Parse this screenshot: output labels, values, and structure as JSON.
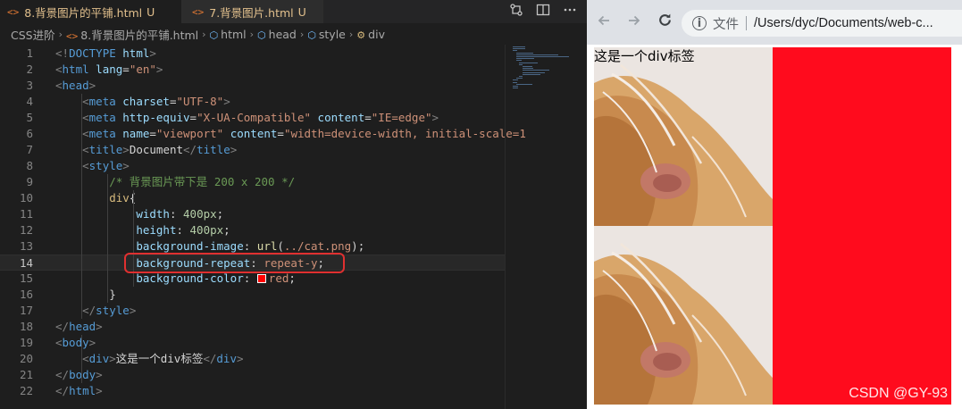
{
  "editor": {
    "tabs": [
      {
        "icon": "<>",
        "label": "8.背景图片的平铺.html",
        "badge": "U",
        "active": true
      },
      {
        "icon": "<>",
        "label": "7.背景图片.html",
        "badge": "U",
        "active": false
      }
    ],
    "breadcrumb": [
      {
        "label": "CSS进阶",
        "icon": ""
      },
      {
        "label": "8.背景图片的平铺.html",
        "icon": "<>"
      },
      {
        "label": "html",
        "icon": "box"
      },
      {
        "label": "head",
        "icon": "box"
      },
      {
        "label": "style",
        "icon": "box"
      },
      {
        "label": "div",
        "icon": "selector"
      }
    ],
    "active_line": 14,
    "lines": [
      {
        "n": "1",
        "tokens": [
          [
            "t-punc",
            "<!"
          ],
          [
            "t-doctype",
            "DOCTYPE"
          ],
          [
            "t-text",
            " "
          ],
          [
            "t-attr",
            "html"
          ],
          [
            "t-punc",
            ">"
          ]
        ]
      },
      {
        "n": "2",
        "tokens": [
          [
            "t-punc",
            "<"
          ],
          [
            "t-tag",
            "html"
          ],
          [
            "t-text",
            " "
          ],
          [
            "t-attr",
            "lang"
          ],
          [
            "t-text",
            "="
          ],
          [
            "t-str",
            "\"en\""
          ],
          [
            "t-punc",
            ">"
          ]
        ]
      },
      {
        "n": "3",
        "tokens": [
          [
            "t-punc",
            "<"
          ],
          [
            "t-tag",
            "head"
          ],
          [
            "t-punc",
            ">"
          ]
        ]
      },
      {
        "n": "4",
        "tokens": [
          [
            "t-text",
            "    "
          ],
          [
            "t-punc",
            "<"
          ],
          [
            "t-tag",
            "meta"
          ],
          [
            "t-text",
            " "
          ],
          [
            "t-attr",
            "charset"
          ],
          [
            "t-text",
            "="
          ],
          [
            "t-str",
            "\"UTF-8\""
          ],
          [
            "t-punc",
            ">"
          ]
        ]
      },
      {
        "n": "5",
        "tokens": [
          [
            "t-text",
            "    "
          ],
          [
            "t-punc",
            "<"
          ],
          [
            "t-tag",
            "meta"
          ],
          [
            "t-text",
            " "
          ],
          [
            "t-attr",
            "http-equiv"
          ],
          [
            "t-text",
            "="
          ],
          [
            "t-str",
            "\"X-UA-Compatible\""
          ],
          [
            "t-text",
            " "
          ],
          [
            "t-attr",
            "content"
          ],
          [
            "t-text",
            "="
          ],
          [
            "t-str",
            "\"IE=edge\""
          ],
          [
            "t-punc",
            ">"
          ]
        ]
      },
      {
        "n": "6",
        "tokens": [
          [
            "t-text",
            "    "
          ],
          [
            "t-punc",
            "<"
          ],
          [
            "t-tag",
            "meta"
          ],
          [
            "t-text",
            " "
          ],
          [
            "t-attr",
            "name"
          ],
          [
            "t-text",
            "="
          ],
          [
            "t-str",
            "\"viewport\""
          ],
          [
            "t-text",
            " "
          ],
          [
            "t-attr",
            "content"
          ],
          [
            "t-text",
            "="
          ],
          [
            "t-str",
            "\"width=device-width, initial-scale=1"
          ]
        ]
      },
      {
        "n": "7",
        "tokens": [
          [
            "t-text",
            "    "
          ],
          [
            "t-punc",
            "<"
          ],
          [
            "t-tag",
            "title"
          ],
          [
            "t-punc",
            ">"
          ],
          [
            "t-text",
            "Document"
          ],
          [
            "t-punc",
            "</"
          ],
          [
            "t-tag",
            "title"
          ],
          [
            "t-punc",
            ">"
          ]
        ]
      },
      {
        "n": "8",
        "tokens": [
          [
            "t-text",
            "    "
          ],
          [
            "t-punc",
            "<"
          ],
          [
            "t-tag",
            "style"
          ],
          [
            "t-punc",
            ">"
          ]
        ]
      },
      {
        "n": "9",
        "tokens": [
          [
            "t-text",
            "        "
          ],
          [
            "t-comment",
            "/* 背景图片带下是 200 x 200 */"
          ]
        ]
      },
      {
        "n": "10",
        "tokens": [
          [
            "t-text",
            "        "
          ],
          [
            "t-sel",
            "div"
          ],
          [
            "t-text",
            "{"
          ]
        ]
      },
      {
        "n": "11",
        "tokens": [
          [
            "t-text",
            "            "
          ],
          [
            "t-prop",
            "width"
          ],
          [
            "t-text",
            ": "
          ],
          [
            "t-num",
            "400px"
          ],
          [
            "t-text",
            ";"
          ]
        ]
      },
      {
        "n": "12",
        "tokens": [
          [
            "t-text",
            "            "
          ],
          [
            "t-prop",
            "height"
          ],
          [
            "t-text",
            ": "
          ],
          [
            "t-num",
            "400px"
          ],
          [
            "t-text",
            ";"
          ]
        ]
      },
      {
        "n": "13",
        "tokens": [
          [
            "t-text",
            "            "
          ],
          [
            "t-prop",
            "background-image"
          ],
          [
            "t-text",
            ": "
          ],
          [
            "t-fn",
            "url"
          ],
          [
            "t-text",
            "("
          ],
          [
            "t-val",
            "../cat.png"
          ],
          [
            "t-text",
            ");"
          ]
        ]
      },
      {
        "n": "14",
        "tokens": [
          [
            "t-text",
            "            "
          ],
          [
            "t-prop",
            "background-repeat"
          ],
          [
            "t-text",
            ": "
          ],
          [
            "t-val",
            "repeat-y"
          ],
          [
            "t-text",
            ";"
          ]
        ]
      },
      {
        "n": "15",
        "tokens": [
          [
            "t-text",
            "            "
          ],
          [
            "t-prop",
            "background-color"
          ],
          [
            "t-text",
            ": "
          ],
          [
            "swatch",
            ""
          ],
          [
            "t-val",
            "red"
          ],
          [
            "t-text",
            ";"
          ]
        ]
      },
      {
        "n": "16",
        "tokens": [
          [
            "t-text",
            "        "
          ],
          [
            "t-text",
            "}"
          ]
        ]
      },
      {
        "n": "17",
        "tokens": [
          [
            "t-text",
            "    "
          ],
          [
            "t-punc",
            "</"
          ],
          [
            "t-tag",
            "style"
          ],
          [
            "t-punc",
            ">"
          ]
        ]
      },
      {
        "n": "18",
        "tokens": [
          [
            "t-punc",
            "</"
          ],
          [
            "t-tag",
            "head"
          ],
          [
            "t-punc",
            ">"
          ]
        ]
      },
      {
        "n": "19",
        "tokens": [
          [
            "t-punc",
            "<"
          ],
          [
            "t-tag",
            "body"
          ],
          [
            "t-punc",
            ">"
          ]
        ]
      },
      {
        "n": "20",
        "tokens": [
          [
            "t-text",
            "    "
          ],
          [
            "t-punc",
            "<"
          ],
          [
            "t-tag",
            "div"
          ],
          [
            "t-punc",
            ">"
          ],
          [
            "t-text",
            "这是一个div标签"
          ],
          [
            "t-punc",
            "</"
          ],
          [
            "t-tag",
            "div"
          ],
          [
            "t-punc",
            ">"
          ]
        ]
      },
      {
        "n": "21",
        "tokens": [
          [
            "t-punc",
            "</"
          ],
          [
            "t-tag",
            "body"
          ],
          [
            "t-punc",
            ">"
          ]
        ]
      },
      {
        "n": "22",
        "tokens": [
          [
            "t-punc",
            "</"
          ],
          [
            "t-tag",
            "html"
          ],
          [
            "t-punc",
            ">"
          ]
        ]
      }
    ]
  },
  "browser": {
    "back_icon": "arrow-left-icon",
    "forward_icon": "arrow-right-icon",
    "reload_icon": "reload-icon",
    "file_label": "文件",
    "url": "/Users/dyc/Documents/web-c...",
    "div_text": "这是一个div标签",
    "background_color": "#ff0b1d",
    "background_repeat": "repeat-y",
    "tile_count": 2
  },
  "watermark": "CSDN @GY-93",
  "colors": {
    "editor_bg": "#1e1e1e",
    "tab_modified": "#e2c08d",
    "highlight_box": "#e03030",
    "div_background": "#ff0b1d"
  }
}
